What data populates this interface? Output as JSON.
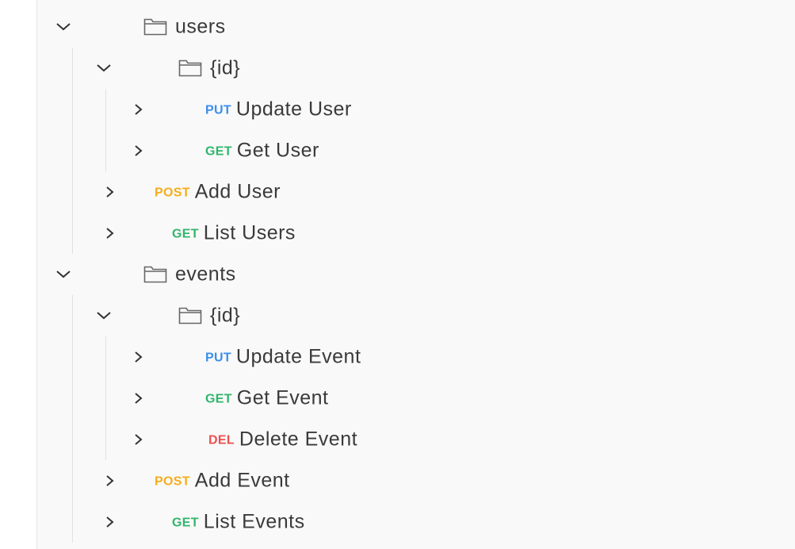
{
  "tree": {
    "users": {
      "label": "users",
      "id_folder": {
        "label": "{id}",
        "requests": [
          {
            "method": "PUT",
            "name": "Update User"
          },
          {
            "method": "GET",
            "name": "Get User"
          }
        ]
      },
      "requests": [
        {
          "method": "POST",
          "name": "Add User"
        },
        {
          "method": "GET",
          "name": "List Users"
        }
      ]
    },
    "events": {
      "label": "events",
      "id_folder": {
        "label": "{id}",
        "requests": [
          {
            "method": "PUT",
            "name": "Update Event"
          },
          {
            "method": "GET",
            "name": "Get Event"
          },
          {
            "method": "DEL",
            "name": "Delete Event"
          }
        ]
      },
      "requests": [
        {
          "method": "POST",
          "name": "Add Event"
        },
        {
          "method": "GET",
          "name": "List Events"
        }
      ]
    }
  },
  "colors": {
    "put": "#3b8eea",
    "get": "#2fb66b",
    "post": "#f5ad1c",
    "del": "#ef4f4f"
  },
  "icons": {
    "expanded": "chevron-down-icon",
    "collapsed": "chevron-right-icon",
    "folder": "folder-icon"
  }
}
